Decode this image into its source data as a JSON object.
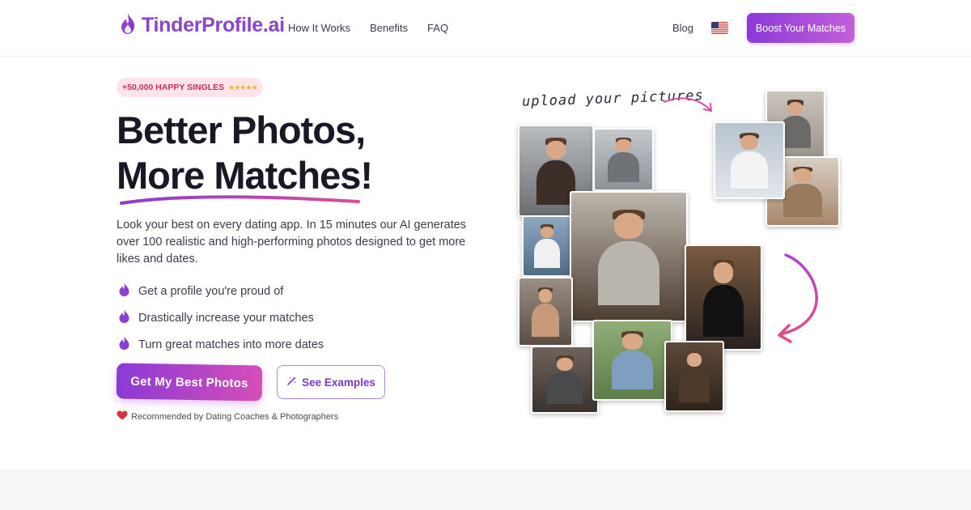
{
  "brand": {
    "name": "TinderProfile.ai",
    "color": "#8b45c9"
  },
  "nav": {
    "items": [
      "How It Works",
      "Benefits",
      "FAQ"
    ],
    "blog": "Blog",
    "locale_flag": "us-flag-icon",
    "boost_label": "Boost Your Matches"
  },
  "hero": {
    "badge_text": "+50,000 HAPPY SINGLES",
    "badge_stars": "★★★★★",
    "title_line1": "Better Photos,",
    "title_line2": "More Matches!",
    "description": "Look your best on every dating app. In 15 minutes our AI generates over 100 realistic and high-performing photos designed to get more likes and dates.",
    "bullets": [
      "Get a profile you're proud of",
      "Drastically increase your matches",
      "Turn great matches into more dates"
    ],
    "cta_primary": "Get My Best Photos",
    "cta_secondary": "See Examples",
    "recommendation": "Recommended by Dating Coaches & Photographers"
  },
  "collage": {
    "caption": "upload your pictures",
    "accent_colors": {
      "arrow_top": "#d64fa6",
      "arrow_right": "#e04c8c"
    }
  },
  "colors": {
    "accent_purple": "#8a3ad9",
    "accent_pink": "#d54eb8",
    "badge_bg": "#fde4ea"
  }
}
